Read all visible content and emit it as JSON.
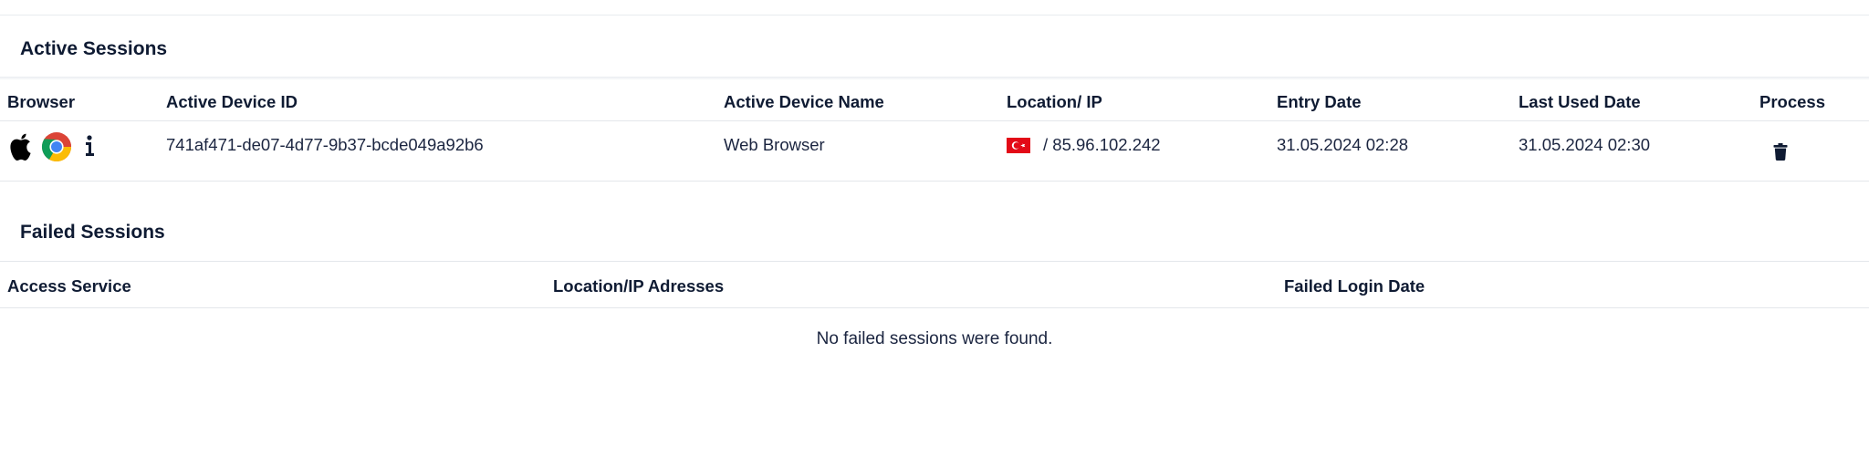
{
  "active_sessions": {
    "title": "Active Sessions",
    "columns": {
      "browser": "Browser",
      "device_id": "Active Device ID",
      "device_name": "Active Device Name",
      "location_ip": "Location/ IP",
      "entry_date": "Entry Date",
      "last_used_date": "Last Used Date",
      "process": "Process"
    },
    "rows": [
      {
        "os_icon": "apple-icon",
        "browser_icon": "chrome-icon",
        "info_icon": "info-icon",
        "device_id": "741af471-de07-4d77-9b37-bcde049a92b6",
        "device_name": "Web Browser",
        "country_flag": "turkey-flag-icon",
        "ip": "/ 85.96.102.242",
        "entry_date": "31.05.2024 02:28",
        "last_used_date": "31.05.2024 02:30",
        "process_icon": "trash-icon"
      }
    ]
  },
  "failed_sessions": {
    "title": "Failed Sessions",
    "columns": {
      "access_service": "Access Service",
      "location_ip": "Location/IP Adresses",
      "failed_login_date": "Failed Login Date"
    },
    "empty_message": "No failed sessions were found."
  },
  "colors": {
    "text": "#0f1b33",
    "divider": "#e4e7eb",
    "flag_red": "#e30a17"
  }
}
